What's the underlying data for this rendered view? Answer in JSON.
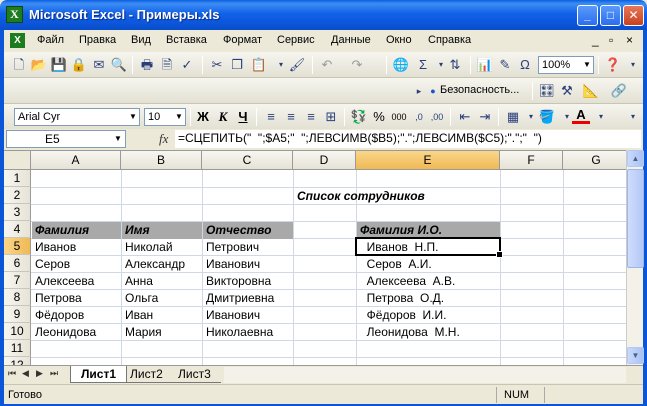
{
  "window": {
    "title": "Microsoft Excel - Примеры.xls",
    "app_icon": "X",
    "minimize_icon": "_",
    "maximize_icon": "□",
    "close_icon": "✕"
  },
  "menu": {
    "items": [
      {
        "label": "Файл"
      },
      {
        "label": "Правка"
      },
      {
        "label": "Вид"
      },
      {
        "label": "Вставка"
      },
      {
        "label": "Формат"
      },
      {
        "label": "Сервис"
      },
      {
        "label": "Данные"
      },
      {
        "label": "Окно"
      },
      {
        "label": "Справка"
      }
    ],
    "doc_min": "_",
    "doc_restore": "▫",
    "doc_close": "×"
  },
  "toolbar_standard": {
    "zoom": "100%",
    "sum_symbol": "Σ",
    "omega_symbol": "Ω"
  },
  "toolbar_format": {
    "font_name": "Arial Cyr",
    "font_size": "10",
    "bold": "Ж",
    "italic": "К",
    "underline": "Ч",
    "percent": "%",
    "thousands": "000",
    "security": "Безопасность..."
  },
  "formula_bar": {
    "name_box": "E5",
    "fx": "fx",
    "formula": "=СЦЕПИТЬ(\"  \";$A5;\"  \";ЛЕВСИМВ($B5);\".\";ЛЕВСИМВ($C5);\".\";\"  \")"
  },
  "grid": {
    "columns": [
      "A",
      "B",
      "C",
      "D",
      "E",
      "F",
      "G"
    ],
    "rows": [
      "1",
      "2",
      "3",
      "4",
      "5",
      "6",
      "7",
      "8",
      "9",
      "10",
      "11",
      "12"
    ],
    "title": "Список сотрудников",
    "headers": {
      "surname": "Фамилия",
      "name": "Имя",
      "patronymic": "Отчество",
      "result": "Фамилия И.О."
    },
    "employees": [
      {
        "surname": "Иванов",
        "name": "Николай",
        "patronymic": "Петрович",
        "short": "  Иванов  Н.П."
      },
      {
        "surname": "Серов",
        "name": "Александр",
        "patronymic": "Иванович",
        "short": "  Серов  А.И."
      },
      {
        "surname": "Алексеева",
        "name": "Анна",
        "patronymic": "Викторовна",
        "short": "  Алексеева  А.В."
      },
      {
        "surname": "Петрова",
        "name": "Ольга",
        "patronymic": "Дмитриевна",
        "short": "  Петрова  О.Д."
      },
      {
        "surname": "Фёдоров",
        "name": "Иван",
        "patronymic": "Иванович",
        "short": "  Фёдоров  И.И."
      },
      {
        "surname": "Леонидова",
        "name": "Мария",
        "patronymic": "Николаевна",
        "short": "  Леонидова  М.Н."
      }
    ]
  },
  "sheets": {
    "tabs": [
      {
        "label": "Лист1"
      },
      {
        "label": "Лист2"
      },
      {
        "label": "Лист3"
      }
    ]
  },
  "status": {
    "ready": "Готово",
    "num": "NUM"
  }
}
